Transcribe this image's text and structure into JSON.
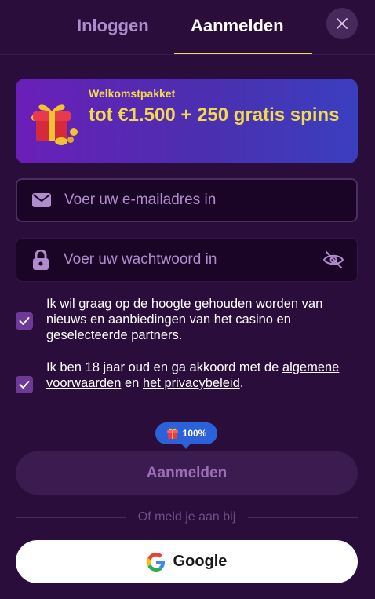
{
  "header": {
    "tabs": [
      {
        "label": "Inloggen",
        "active": false
      },
      {
        "label": "Aanmelden",
        "active": true
      }
    ],
    "close_icon": "close-icon"
  },
  "banner": {
    "subtitle": "Welkomstpakket",
    "title": "tot €1.500 + 250 gratis spins",
    "icon": "gift-icon"
  },
  "form": {
    "email": {
      "placeholder": "Voer uw e-mailadres in",
      "value": "",
      "icon": "envelope-icon"
    },
    "password": {
      "placeholder": "Voer uw wachtwoord in",
      "value": "",
      "icon": "lock-icon",
      "toggle_icon": "eye-hidden-icon"
    },
    "newsletter": {
      "checked": true,
      "text": "Ik wil graag op de hoogte gehouden worden van nieuws en aanbiedingen van het casino en geselecteerde partners."
    },
    "terms": {
      "checked": true,
      "text_before": "Ik ben 18 jaar oud en ga akkoord met de",
      "link_terms": "algemene voorwaarden",
      "text_middle": "en",
      "link_privacy": "het privacybeleid",
      "text_after": "."
    },
    "progress_badge": "100%",
    "submit_label": "Aanmelden"
  },
  "social": {
    "divider_text": "Of meld je aan bij",
    "google_label": "Google"
  },
  "colors": {
    "background": "#2b0d3c",
    "accent_yellow": "#f2d94e",
    "muted_purple": "#b08ccc",
    "checkbox": "#6e3a99",
    "badge_blue": "#2c62d9"
  }
}
